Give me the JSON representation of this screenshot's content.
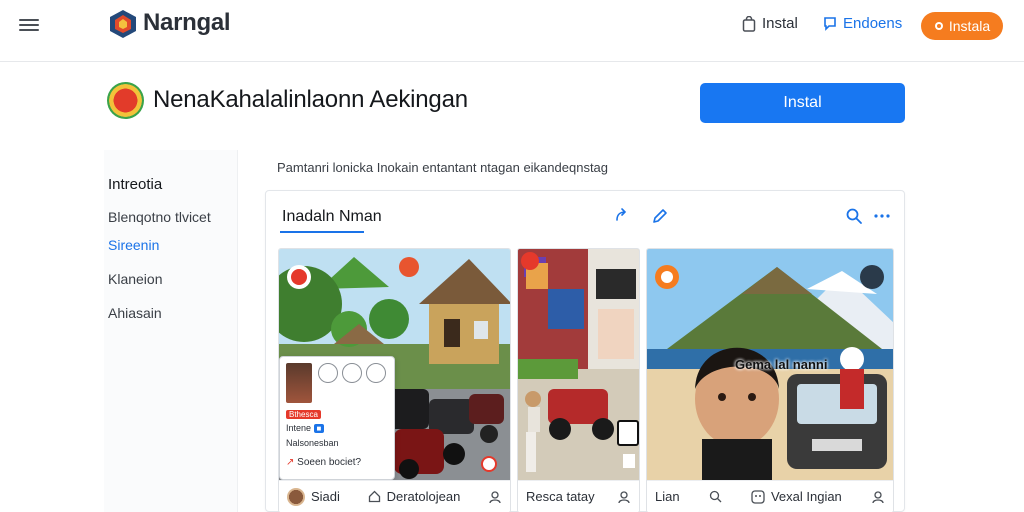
{
  "header": {
    "brand": "Narngal",
    "install_link": "Instal",
    "reviews_link": "Endoens",
    "cta": "Instala"
  },
  "app": {
    "title": "NenaKahalalinlaonn Aekingan",
    "install_button": "Instal"
  },
  "sidebar": {
    "heading": "Intreotia",
    "items": [
      {
        "label": "Blenqotno tlvicet"
      },
      {
        "label": "Sireenin"
      },
      {
        "label": "Klaneion"
      },
      {
        "label": "Ahiasain"
      }
    ]
  },
  "main": {
    "breadcrumb": "Pamtanri lonicka Inokain entantant ntagan eikandeqnstag",
    "card_title": "Inadaln Nman",
    "popup": {
      "line1": "Bthesca",
      "line2": "Intene",
      "line3": "Nalsonesban",
      "line4": "Soeen bociet?"
    },
    "tiles": [
      {
        "caption": "Siadi",
        "caption2": "Deratolojean"
      },
      {
        "caption": "Resca tatay"
      },
      {
        "caption": "Lian",
        "caption2": "Vexal Ingian",
        "overlay": "Gema lal nanni"
      }
    ]
  },
  "colors": {
    "accent_blue": "#1a73e8",
    "cta_orange": "#f57c1f",
    "install_blue": "#1877f2"
  }
}
